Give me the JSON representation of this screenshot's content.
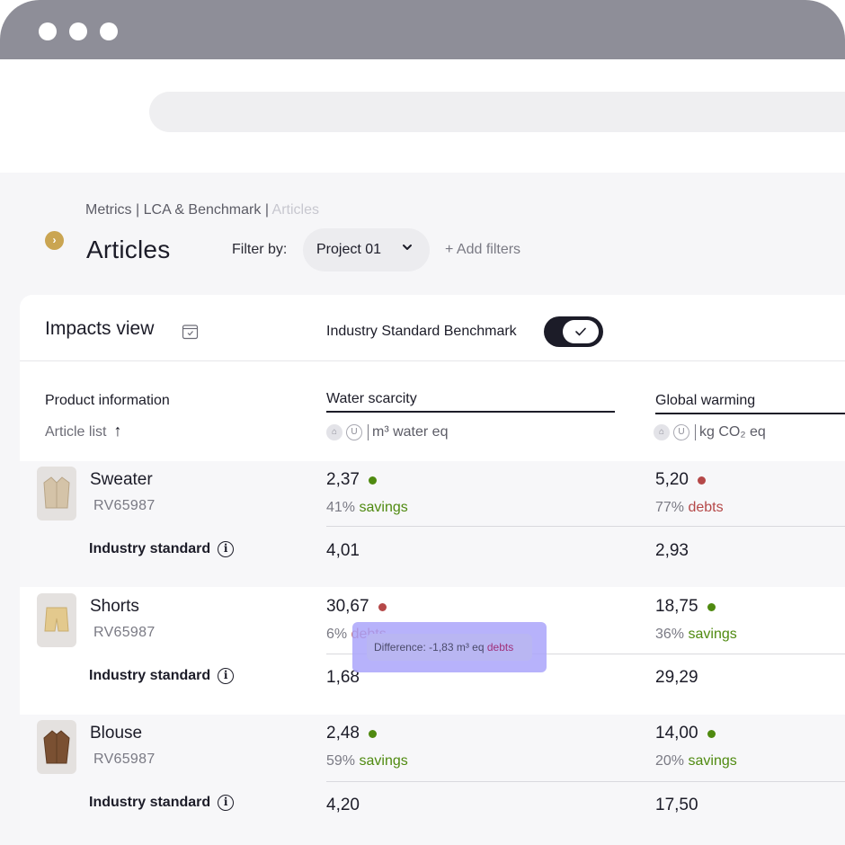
{
  "breadcrumb": {
    "part1": "Metrics",
    "sep": "|",
    "part2": "LCA & Benchmark",
    "part3": "Articles"
  },
  "page": {
    "title": "Articles",
    "filter_label": "Filter by:",
    "project": "Project 01",
    "add_filters": "+ Add filters"
  },
  "card": {
    "impacts_title": "Impacts view",
    "benchmark_label": "Industry Standard Benchmark",
    "benchmark_on": true,
    "product_info": "Product information",
    "article_list": "Article list",
    "article_list_arrow": "↑"
  },
  "metrics": [
    {
      "name": "Water scarcity",
      "unit": "m³ water eq"
    },
    {
      "name": "Global warming",
      "unit": "kg CO₂ eq"
    }
  ],
  "industry_standard_label": "Industry standard",
  "colors": {
    "savings": "#4f8a10",
    "debts": "#b54848",
    "accent": "#caa552"
  },
  "products": [
    {
      "name": "Sweater",
      "code": "RV65987",
      "water": {
        "value": "2,37",
        "status": "savings",
        "pct": "41%",
        "label": "savings",
        "std": "4,01"
      },
      "warming": {
        "value": "5,20",
        "status": "debts",
        "pct": "77%",
        "label": "debts",
        "std": "2,93"
      }
    },
    {
      "name": "Shorts",
      "code": "RV65987",
      "water": {
        "value": "30,67",
        "status": "debts",
        "pct": "6%",
        "label": "debts",
        "std": "1,68"
      },
      "warming": {
        "value": "18,75",
        "status": "savings",
        "pct": "36%",
        "label": "savings",
        "std": "29,29"
      }
    },
    {
      "name": "Blouse",
      "code": "RV65987",
      "water": {
        "value": "2,48",
        "status": "savings",
        "pct": "59%",
        "label": "savings",
        "std": "4,20"
      },
      "warming": {
        "value": "14,00",
        "status": "savings",
        "pct": "20%",
        "label": "savings",
        "std": "17,50"
      }
    }
  ],
  "tooltip": {
    "text": "Difference: -1,83 m³ eq",
    "label": "debts"
  }
}
